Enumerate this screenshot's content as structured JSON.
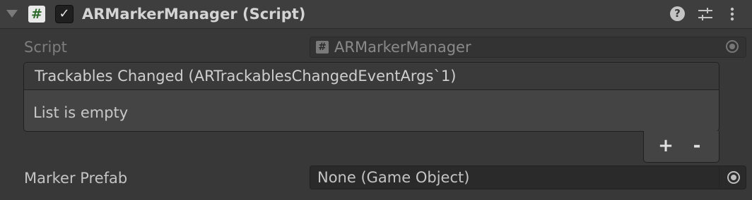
{
  "component": {
    "title": "ARMarkerManager (Script)",
    "enabled": true
  },
  "icons": {
    "foldout": "foldout-expanded-icon",
    "script": "#",
    "enabled_check": "✓",
    "help": "?",
    "presets": "presets-icon",
    "menu": "kebab-menu-icon"
  },
  "script_field": {
    "label": "Script",
    "value": "ARMarkerManager",
    "icon": "#"
  },
  "event": {
    "title": "Trackables Changed (ARTrackablesChangedEventArgs`1)",
    "empty_text": "List is empty",
    "add_label": "+",
    "remove_label": "-"
  },
  "marker_prefab": {
    "label": "Marker Prefab",
    "value": "None (Game Object)"
  },
  "colors": {
    "background": "#383838",
    "header": "#3e3e3e",
    "field": "#2a2a2a",
    "text": "#c4c4c4",
    "script_icon_green": "#2f6b2c"
  }
}
